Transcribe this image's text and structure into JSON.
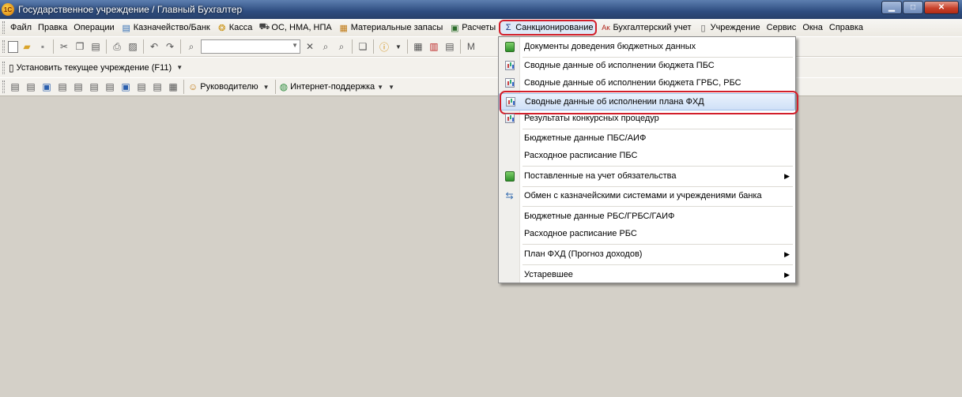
{
  "window": {
    "title": "Государственное учреждение / Главный Бухгалтер",
    "logo_text": "1С",
    "buttons": {
      "minimize": "▁",
      "maximize": "□",
      "close": "✕"
    }
  },
  "menubar": {
    "items": [
      {
        "label": "Файл",
        "icon": ""
      },
      {
        "label": "Правка",
        "icon": ""
      },
      {
        "label": "Операции",
        "icon": ""
      },
      {
        "label": "Казначейство/Банк",
        "icon": "bank-icon"
      },
      {
        "label": "Касса",
        "icon": "cash-icon"
      },
      {
        "label": "ОС, НМА, НПА",
        "icon": "truck-icon"
      },
      {
        "label": "Материальные запасы",
        "icon": "stock-icon"
      },
      {
        "label": "Расчеты",
        "icon": "payments-icon"
      },
      {
        "label": "Санкционирование",
        "icon": "sigma-icon",
        "active": true
      },
      {
        "label": "Бухгалтерский учет",
        "icon": "accounting-icon"
      },
      {
        "label": "Учреждение",
        "icon": "institution-icon"
      },
      {
        "label": "Сервис",
        "icon": ""
      },
      {
        "label": "Окна",
        "icon": ""
      },
      {
        "label": "Справка",
        "icon": ""
      }
    ]
  },
  "toolbar2": {
    "set_institution": "Установить текущее учреждение (F11)"
  },
  "toolbar3": {
    "manager": "Руководителю",
    "support": "Интернет-поддержка"
  },
  "dropdown": {
    "items": [
      {
        "label": "Документы доведения бюджетных данных",
        "icon": "green"
      },
      {
        "label": "Сводные данные об исполнении бюджета ПБС",
        "icon": "chart"
      },
      {
        "label": "Сводные данные об исполнении бюджета ГРБС, РБС",
        "icon": "chart"
      },
      {
        "label": "Сводные данные об исполнении плана ФХД",
        "icon": "chart",
        "highlighted": true
      },
      {
        "label": "Результаты конкурсных процедур",
        "icon": "chart"
      },
      {
        "label": "Бюджетные данные ПБС/АИФ",
        "icon": ""
      },
      {
        "label": "Расходное расписание ПБС",
        "icon": ""
      },
      {
        "label": "Поставленные на учет обязательства",
        "icon": "green",
        "submenu": true
      },
      {
        "label": "Обмен с казначейскими системами и учреждениями банка",
        "icon": "exchange"
      },
      {
        "label": "Бюджетные данные РБС/ГРБС/ГАИФ",
        "icon": ""
      },
      {
        "label": "Расходное расписание РБС",
        "icon": ""
      },
      {
        "label": "План ФХД (Прогноз доходов)",
        "icon": "",
        "submenu": true
      },
      {
        "label": "Устаревшее",
        "icon": "",
        "submenu": true
      }
    ]
  },
  "colors": {
    "highlight_outline": "#d21f2b",
    "workspace": "#d4d0c8"
  }
}
